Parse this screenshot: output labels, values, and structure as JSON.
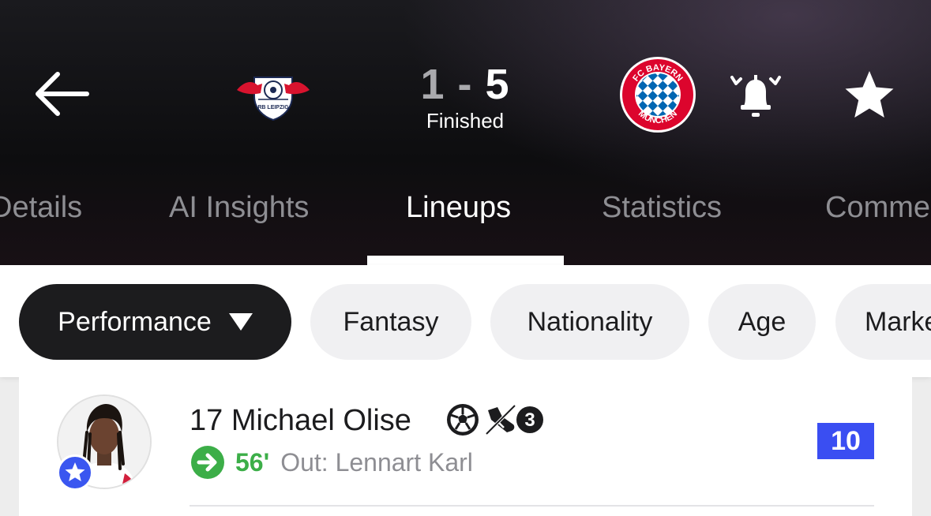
{
  "header": {
    "back_icon": "arrow-left-icon",
    "home_team": {
      "logo": "rb-leipzig-crest",
      "logo_text": "RB LEIPZIG"
    },
    "away_team": {
      "logo": "fc-bayern-munchen-crest",
      "logo_text": "FC BAYERN MÜNCHEN"
    },
    "score": {
      "home": "1",
      "separator": "-",
      "away": "5"
    },
    "status": "Finished",
    "bell_icon": "bell-alert-icon",
    "star_icon": "star-favorite-icon"
  },
  "tabs": [
    {
      "label": "Details",
      "active": false
    },
    {
      "label": "AI Insights",
      "active": false
    },
    {
      "label": "Lineups",
      "active": true
    },
    {
      "label": "Statistics",
      "active": false
    },
    {
      "label": "Commentary",
      "active": false
    }
  ],
  "filters": [
    {
      "label": "Performance",
      "selected": true,
      "has_dropdown": true
    },
    {
      "label": "Fantasy",
      "selected": false
    },
    {
      "label": "Nationality",
      "selected": false
    },
    {
      "label": "Age",
      "selected": false
    },
    {
      "label": "Market value",
      "selected": false
    }
  ],
  "player": {
    "name_line": "17 Michael Olise",
    "event_icons": [
      "goal-ball-icon",
      "assist-boot-icon"
    ],
    "assist_count": "3",
    "substitution": {
      "icon": "substitution-out-icon",
      "minute": "56'",
      "text": "Out: Lennart Karl"
    },
    "rating": "10",
    "badge_icon": "player-of-the-match-star-icon"
  },
  "colors": {
    "header_bg": "#0d0d0f",
    "chip_selected_bg": "#1c1c1e",
    "rating_bg": "#3a4ef2",
    "sub_green": "#3cae48",
    "bayern_red": "#dc052d",
    "bayern_blue": "#0066b2"
  }
}
